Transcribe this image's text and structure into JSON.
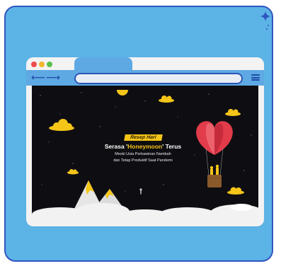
{
  "banner": {
    "tag_label": "Resep Hari",
    "headline_before": "Serasa '",
    "headline_highlight": "Honeymoon",
    "headline_after": "' Terus",
    "subline_1": "Meski Usia Perkawinan Nambah",
    "subline_2": "dan Tetap Produktif Saat Pandemi"
  },
  "colors": {
    "card_background": "#5cb3e6",
    "card_border": "#2f55c0",
    "browser_toolbar": "#5ea9e3",
    "scene_background": "#0e0e12",
    "accent_gold": "#f5c518",
    "balloon_red": "#e23b4a"
  },
  "window_controls": [
    "close",
    "minimize",
    "maximize"
  ],
  "icons": [
    "back-arrow-icon",
    "forward-arrow-icon",
    "hamburger-menu-icon",
    "sparkle-icon"
  ]
}
